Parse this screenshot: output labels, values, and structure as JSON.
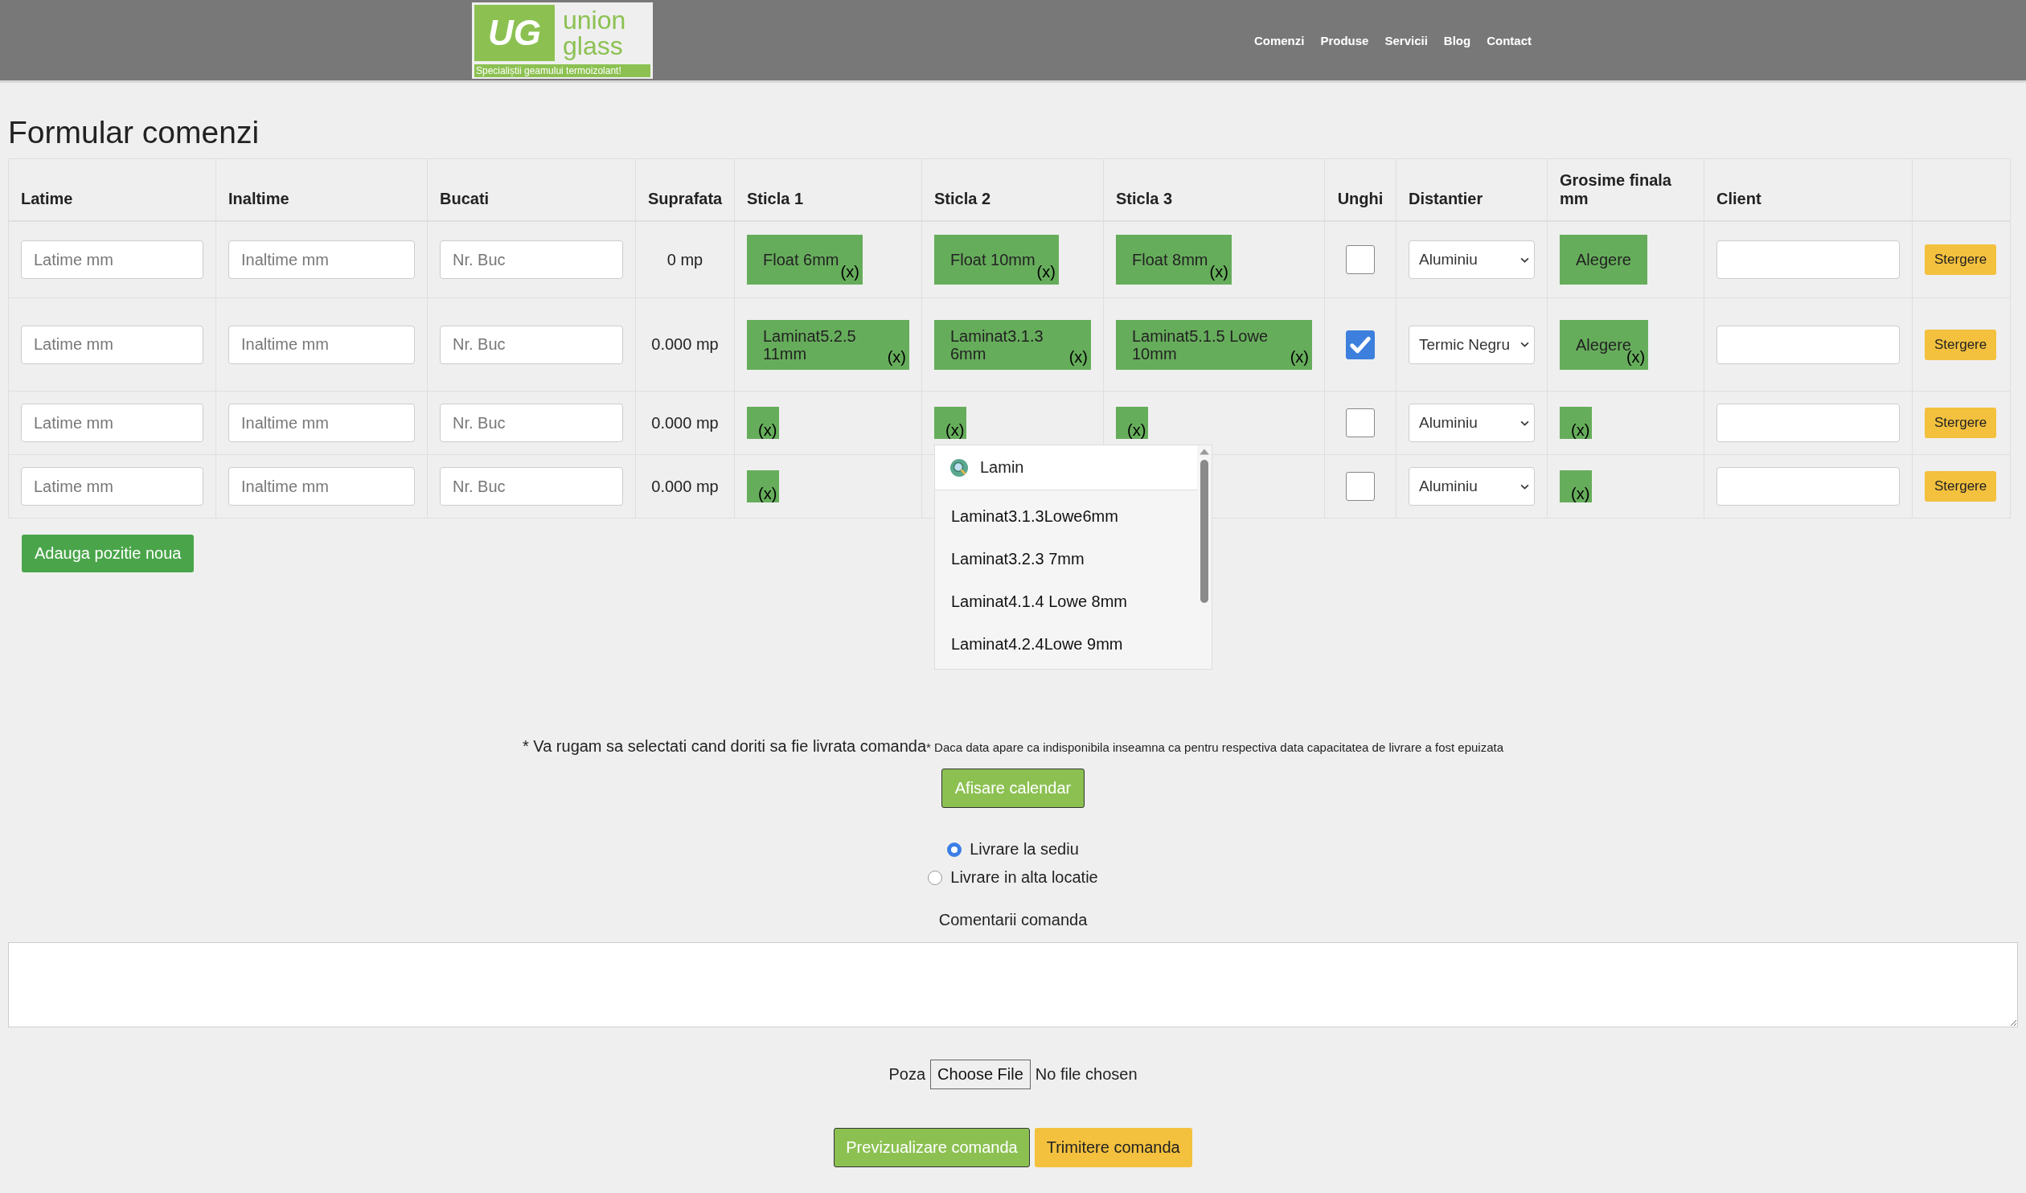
{
  "header": {
    "logo": {
      "mark": "UG",
      "word_1": "union",
      "word_2": "glass",
      "tagline": "Specialiștii geamului termoizolant!"
    },
    "nav": [
      "Comenzi",
      "Produse",
      "Servicii",
      "Blog",
      "Contact"
    ]
  },
  "title": "Formular comenzi",
  "table": {
    "columns": [
      "Latime",
      "Inaltime",
      "Bucati",
      "Suprafata",
      "Sticla 1",
      "Sticla 2",
      "Sticla 3",
      "Unghi",
      "Distantier",
      "Grosime finala mm",
      "Client"
    ],
    "rows": [
      {
        "width_placeholder": "Latime mm",
        "height_placeholder": "Inaltime mm",
        "pieces_placeholder": "Nr. Buc",
        "area": "0 mp",
        "glass": [
          {
            "kind": "filled",
            "label": "Float 6mm",
            "remove": "(x)"
          },
          {
            "kind": "filled",
            "label": "Float 10mm",
            "remove": "(x)"
          },
          {
            "kind": "filled",
            "label": "Float 8mm",
            "remove": "(x)"
          }
        ],
        "angles_checked": false,
        "spacer": "Aluminiu",
        "thickness": {
          "kind": "filled",
          "label": "Alegere"
        },
        "delete": "Stergere"
      },
      {
        "width_placeholder": "Latime mm",
        "height_placeholder": "Inaltime mm",
        "pieces_placeholder": "Nr. Buc",
        "area": "0.000 mp",
        "glass": [
          {
            "kind": "filled",
            "label": "Laminat5.2.5 11mm",
            "remove": "(x)"
          },
          {
            "kind": "filled",
            "label": "Laminat3.1.3 6mm",
            "remove": "(x)"
          },
          {
            "kind": "filled",
            "label": "Laminat5.1.5 Lowe 10mm",
            "remove": "(x)"
          }
        ],
        "angles_checked": true,
        "spacer": "Termic Negru",
        "thickness": {
          "kind": "filled",
          "label": "Alegere",
          "remove": "(x)"
        },
        "delete": "Stergere"
      },
      {
        "width_placeholder": "Latime mm",
        "height_placeholder": "Inaltime mm",
        "pieces_placeholder": "Nr. Buc",
        "area": "0.000 mp",
        "glass": [
          {
            "kind": "empty",
            "remove": "(x)"
          },
          {
            "kind": "empty",
            "remove": "(x)",
            "dropdown": {
              "search": "Lamin",
              "options": [
                "Laminat3.1.3Lowe6mm",
                "Laminat3.2.3 7mm",
                "Laminat4.1.4 Lowe 8mm",
                "Laminat4.2.4Lowe 9mm"
              ]
            }
          },
          {
            "kind": "empty",
            "remove": "(x)"
          }
        ],
        "angles_checked": false,
        "spacer": "Aluminiu",
        "thickness": {
          "kind": "empty",
          "remove": "(x)"
        },
        "delete": "Stergere"
      },
      {
        "width_placeholder": "Latime mm",
        "height_placeholder": "Inaltime mm",
        "pieces_placeholder": "Nr. Buc",
        "area": "0.000 mp",
        "glass": [
          {
            "kind": "empty",
            "remove": "(x)"
          }
        ],
        "angles_checked": false,
        "spacer": "Aluminiu",
        "thickness": {
          "kind": "empty",
          "remove": "(x)"
        },
        "delete": "Stergere"
      }
    ]
  },
  "add_button": "Adauga pozitie noua",
  "delivery_note": "* Va rugam sa selectati cand doriti sa fie livrata comanda",
  "delivery_hint": "* Daca data apare ca indisponibila inseamna ca pentru respectiva data capacitatea de livrare a fost epuizata",
  "calendar_button": "Afisare calendar",
  "delivery_options": [
    {
      "label": "Livrare la sediu",
      "selected": true
    },
    {
      "label": "Livrare in alta locatie",
      "selected": false
    }
  ],
  "comments_label": "Comentarii comanda",
  "photo": {
    "label": "Poza",
    "button": "Choose File",
    "status": "No file chosen"
  },
  "preview_button": "Previzualizare comanda",
  "submit_button": "Trimitere comanda"
}
